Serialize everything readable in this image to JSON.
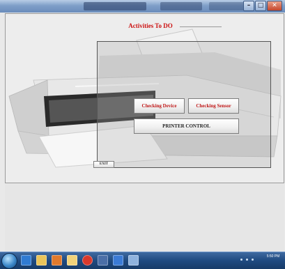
{
  "window": {
    "controls": {
      "minimize": "–",
      "maximize": "□",
      "close": "✕"
    }
  },
  "app": {
    "title": "Activities To DO",
    "buttons": {
      "checking_device": "Checking Device",
      "checking_sensor": "Checking Sensor",
      "printer_control": "PRINTER CONTROL",
      "exit": "EXIT"
    }
  },
  "taskbar": {
    "icons": [
      "start-orb-icon",
      "ie-icon",
      "folder-icon",
      "media-player-icon",
      "explorer-icon",
      "chrome-icon",
      "app-icon",
      "word-icon",
      "app-window-icon"
    ],
    "clock_time": "5:50 PM",
    "clock_date": ""
  },
  "colors": {
    "title_red": "#cc1111",
    "taskbar": "#1f4a80"
  }
}
